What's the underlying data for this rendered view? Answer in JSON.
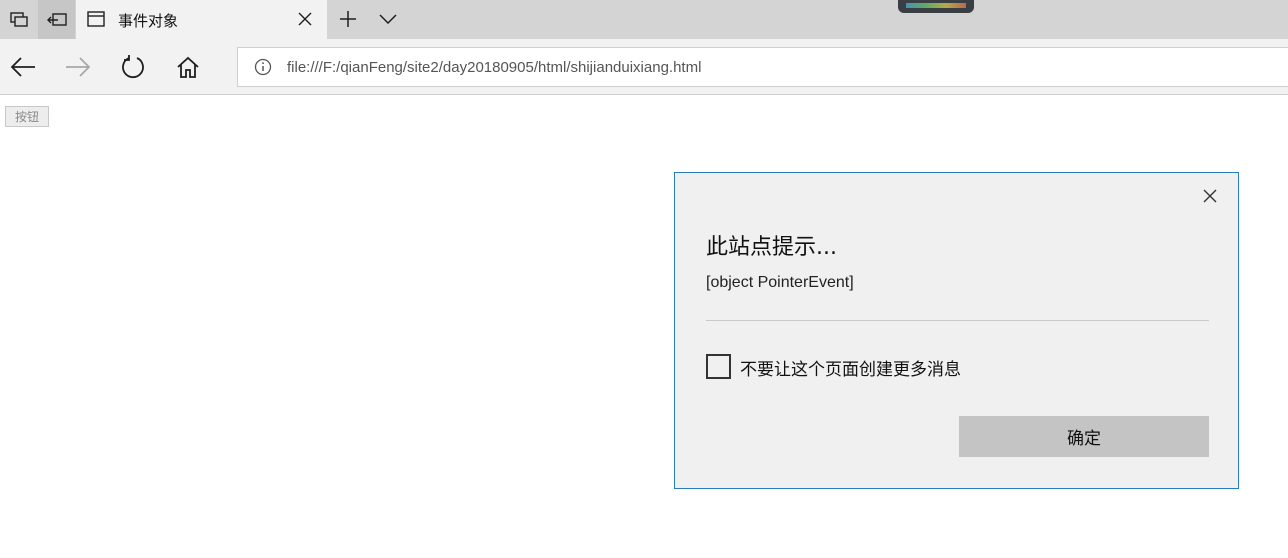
{
  "browser": {
    "tab": {
      "title": "事件对象"
    },
    "address_bar": {
      "url": "file:///F:/qianFeng/site2/day20180905/html/shijianduixiang.html"
    }
  },
  "page": {
    "button_label": "按钮"
  },
  "dialog": {
    "title": "此站点提示...",
    "message": "[object PointerEvent]",
    "checkbox_label": "不要让这个页面创建更多消息",
    "checkbox_checked": false,
    "ok_label": "确定"
  },
  "colors": {
    "tabbar": "#d4d4d4",
    "active_tab": "#f2f2f2",
    "dialog_border": "#2b7bbf",
    "dialog_bg": "#f0f0f0",
    "ok_button": "#c4c4c4"
  },
  "icons": [
    "tab-preview-icon",
    "set-aside-tabs-icon",
    "page-icon",
    "close-icon",
    "plus-icon",
    "chevron-down-icon",
    "back-arrow-icon",
    "forward-arrow-icon",
    "refresh-icon",
    "home-icon",
    "info-icon"
  ]
}
